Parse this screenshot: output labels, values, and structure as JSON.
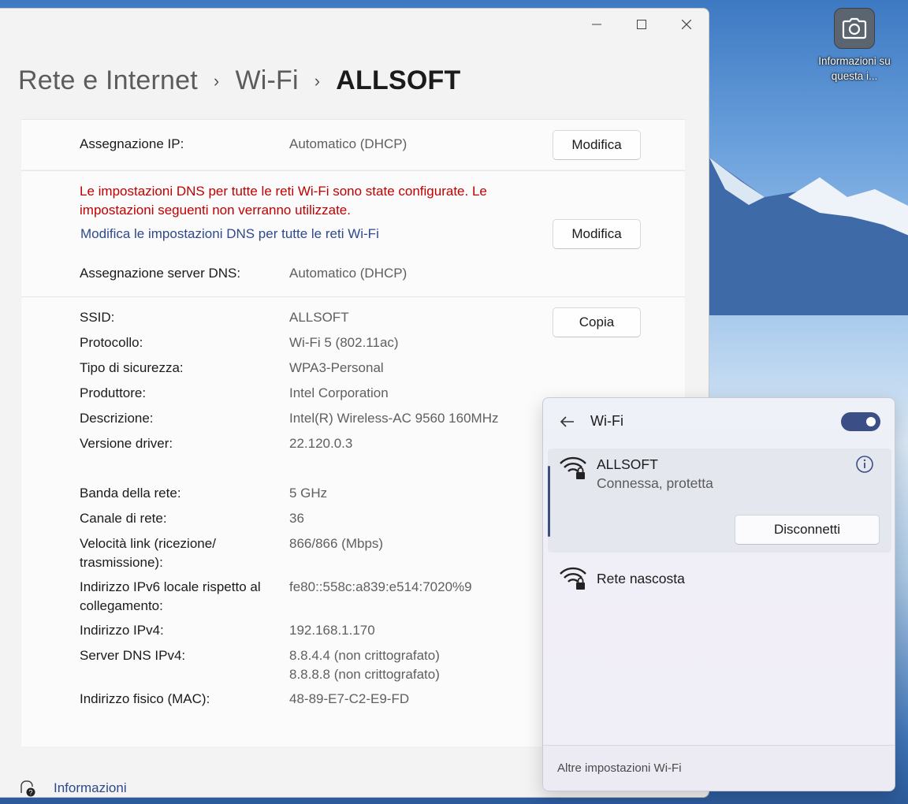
{
  "desktop": {
    "icon_label": "Informazioni su questa i..."
  },
  "window": {
    "breadcrumb": [
      "Rete e Internet",
      "Wi-Fi",
      "ALLSOFT"
    ],
    "ip": {
      "label": "Assegnazione IP:",
      "value": "Automatico (DHCP)",
      "button": "Modifica"
    },
    "dns": {
      "warning": "Le impostazioni DNS per tutte le reti Wi-Fi sono state configurate. Le impostazioni seguenti non verranno utilizzate.",
      "link": "Modifica le impostazioni DNS per tutte le reti Wi-Fi",
      "button": "Modifica",
      "label": "Assegnazione server DNS:",
      "value": "Automatico (DHCP)"
    },
    "copy_button": "Copia",
    "properties": [
      {
        "label": "SSID:",
        "value": "ALLSOFT"
      },
      {
        "label": "Protocollo:",
        "value": "Wi-Fi 5 (802.11ac)"
      },
      {
        "label": "Tipo di sicurezza:",
        "value": "WPA3-Personal"
      },
      {
        "label": "Produttore:",
        "value": "Intel Corporation"
      },
      {
        "label": "Descrizione:",
        "value": "Intel(R) Wireless-AC 9560 160MHz"
      },
      {
        "label": "Versione driver:",
        "value": "22.120.0.3"
      },
      {
        "label": "Banda della rete:",
        "value": "5 GHz"
      },
      {
        "label": "Canale di rete:",
        "value": "36"
      },
      {
        "label": "Velocità link (ricezione/ trasmissione):",
        "value": "866/866 (Mbps)"
      },
      {
        "label": "Indirizzo IPv6 locale rispetto al collegamento:",
        "value": "fe80::558c:a839:e514:7020%9"
      },
      {
        "label": "Indirizzo IPv4:",
        "value": "192.168.1.170"
      },
      {
        "label": "Server DNS IPv4:",
        "value": "8.8.4.4 (non crittografato)\n8.8.8.8 (non crittografato)"
      },
      {
        "label": "Indirizzo fisico (MAC):",
        "value": "48-89-E7-C2-E9-FD"
      }
    ],
    "footer_link": "Informazioni"
  },
  "flyout": {
    "title": "Wi-Fi",
    "toggle_on": true,
    "networks": [
      {
        "name": "ALLSOFT",
        "status": "Connessa, protetta",
        "button": "Disconnetti"
      },
      {
        "name": "Rete nascosta"
      }
    ],
    "footer": "Altre impostazioni Wi-Fi"
  },
  "colors": {
    "accent": "#3b4f86",
    "warning": "#c00000",
    "link": "#2e4a8a"
  }
}
